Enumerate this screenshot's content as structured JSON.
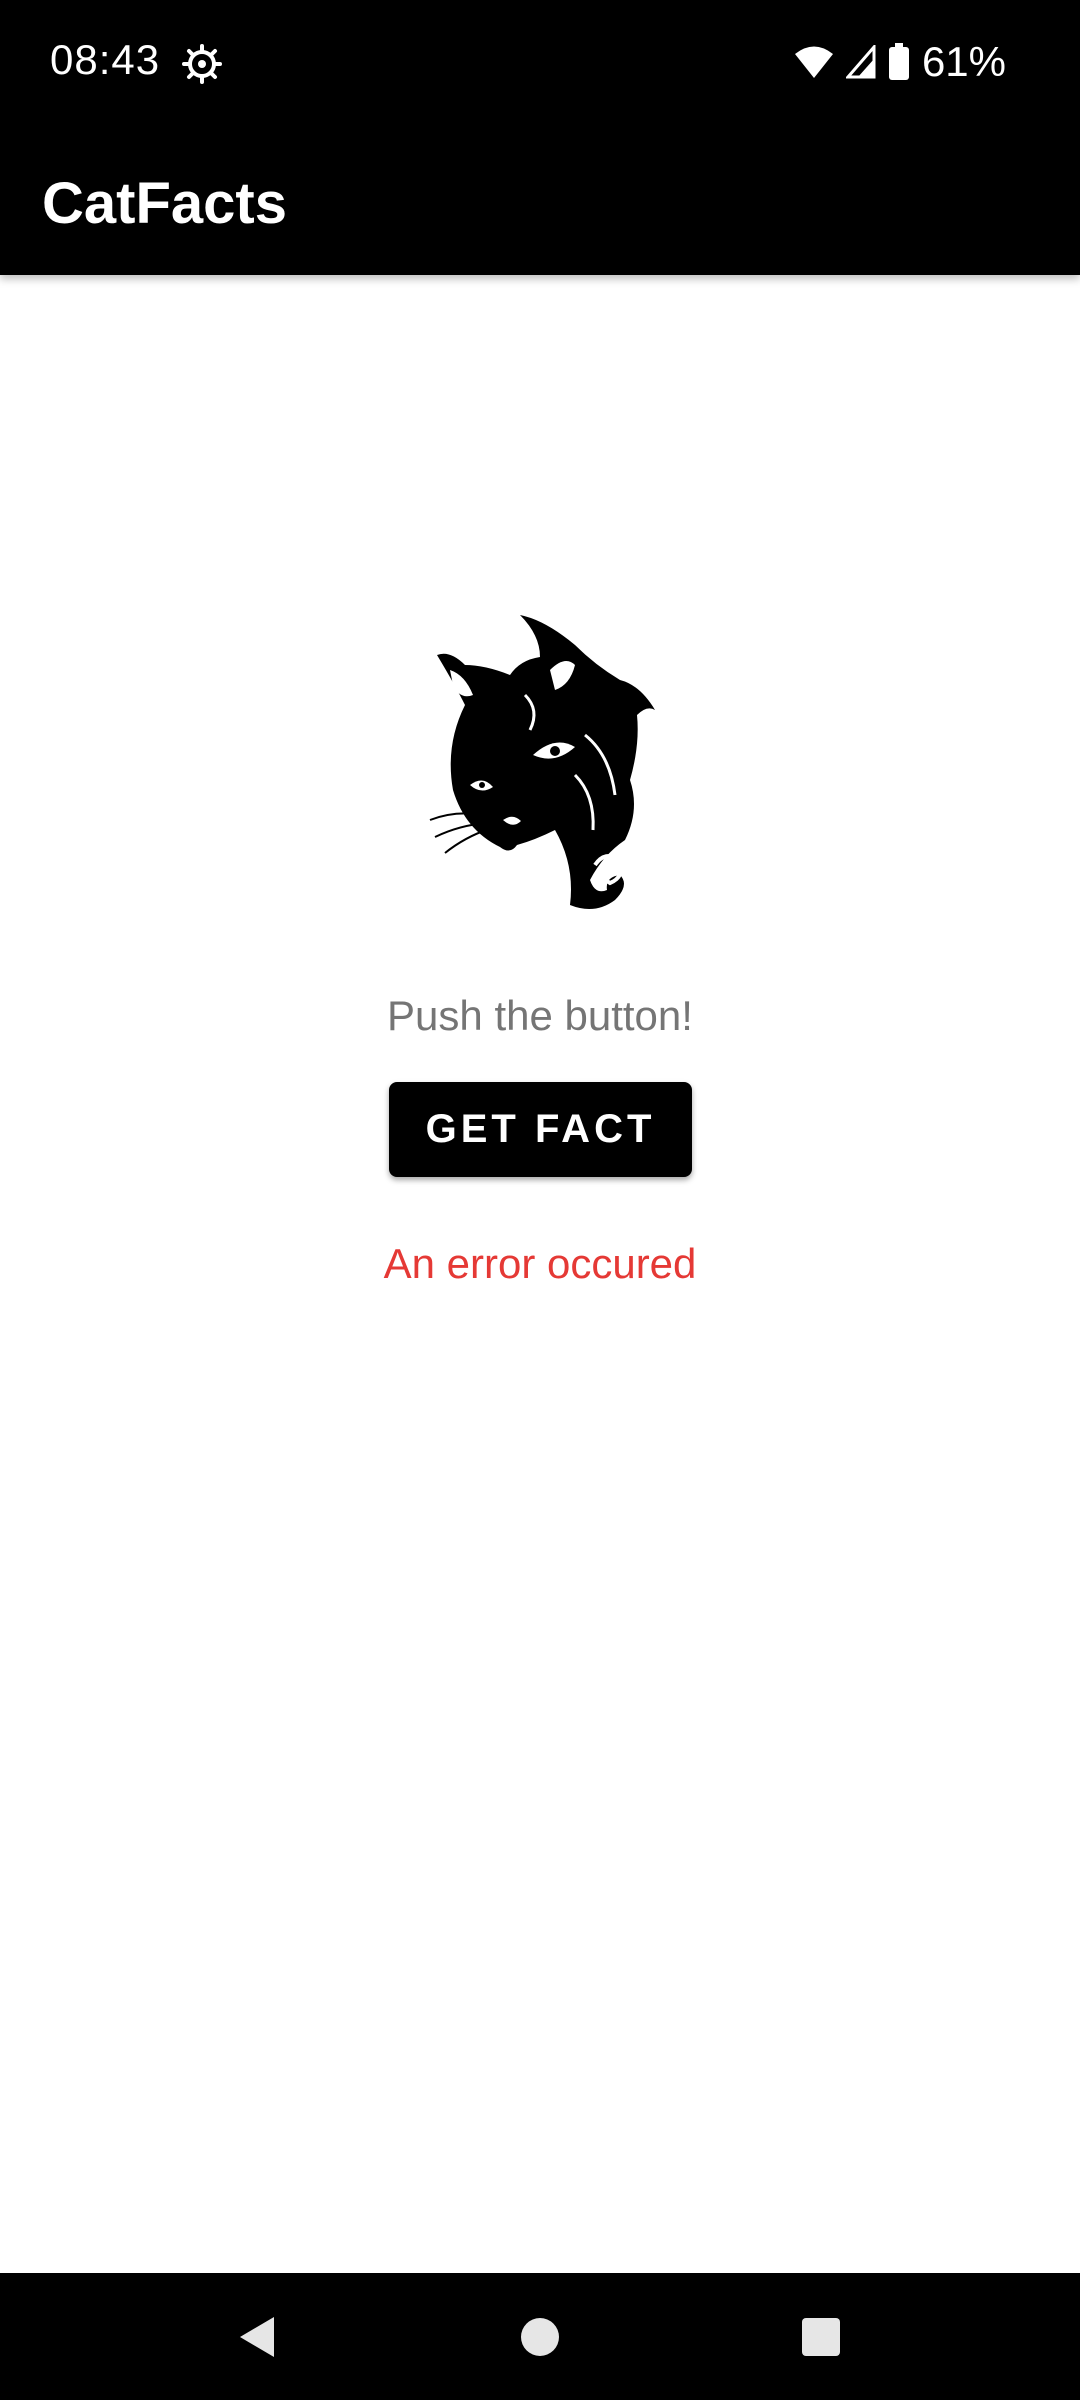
{
  "status_bar": {
    "time": "08:43",
    "battery_percent": "61%",
    "icons": [
      "settings-gear-icon",
      "wifi-icon",
      "cell-signal-icon",
      "battery-icon"
    ]
  },
  "app_bar": {
    "title": "CatFacts"
  },
  "main": {
    "image_icon": "cat-head-illustration",
    "prompt": "Push the button!",
    "button_label": "GET FACT",
    "error_message": "An error occured"
  },
  "nav_bar": {
    "buttons": [
      "back-icon",
      "home-icon",
      "recents-icon"
    ]
  },
  "colors": {
    "bars": "#000000",
    "background": "#ffffff",
    "prompt_text": "#757575",
    "error_text": "#e53935",
    "button_bg": "#000000",
    "button_text": "#ffffff"
  }
}
